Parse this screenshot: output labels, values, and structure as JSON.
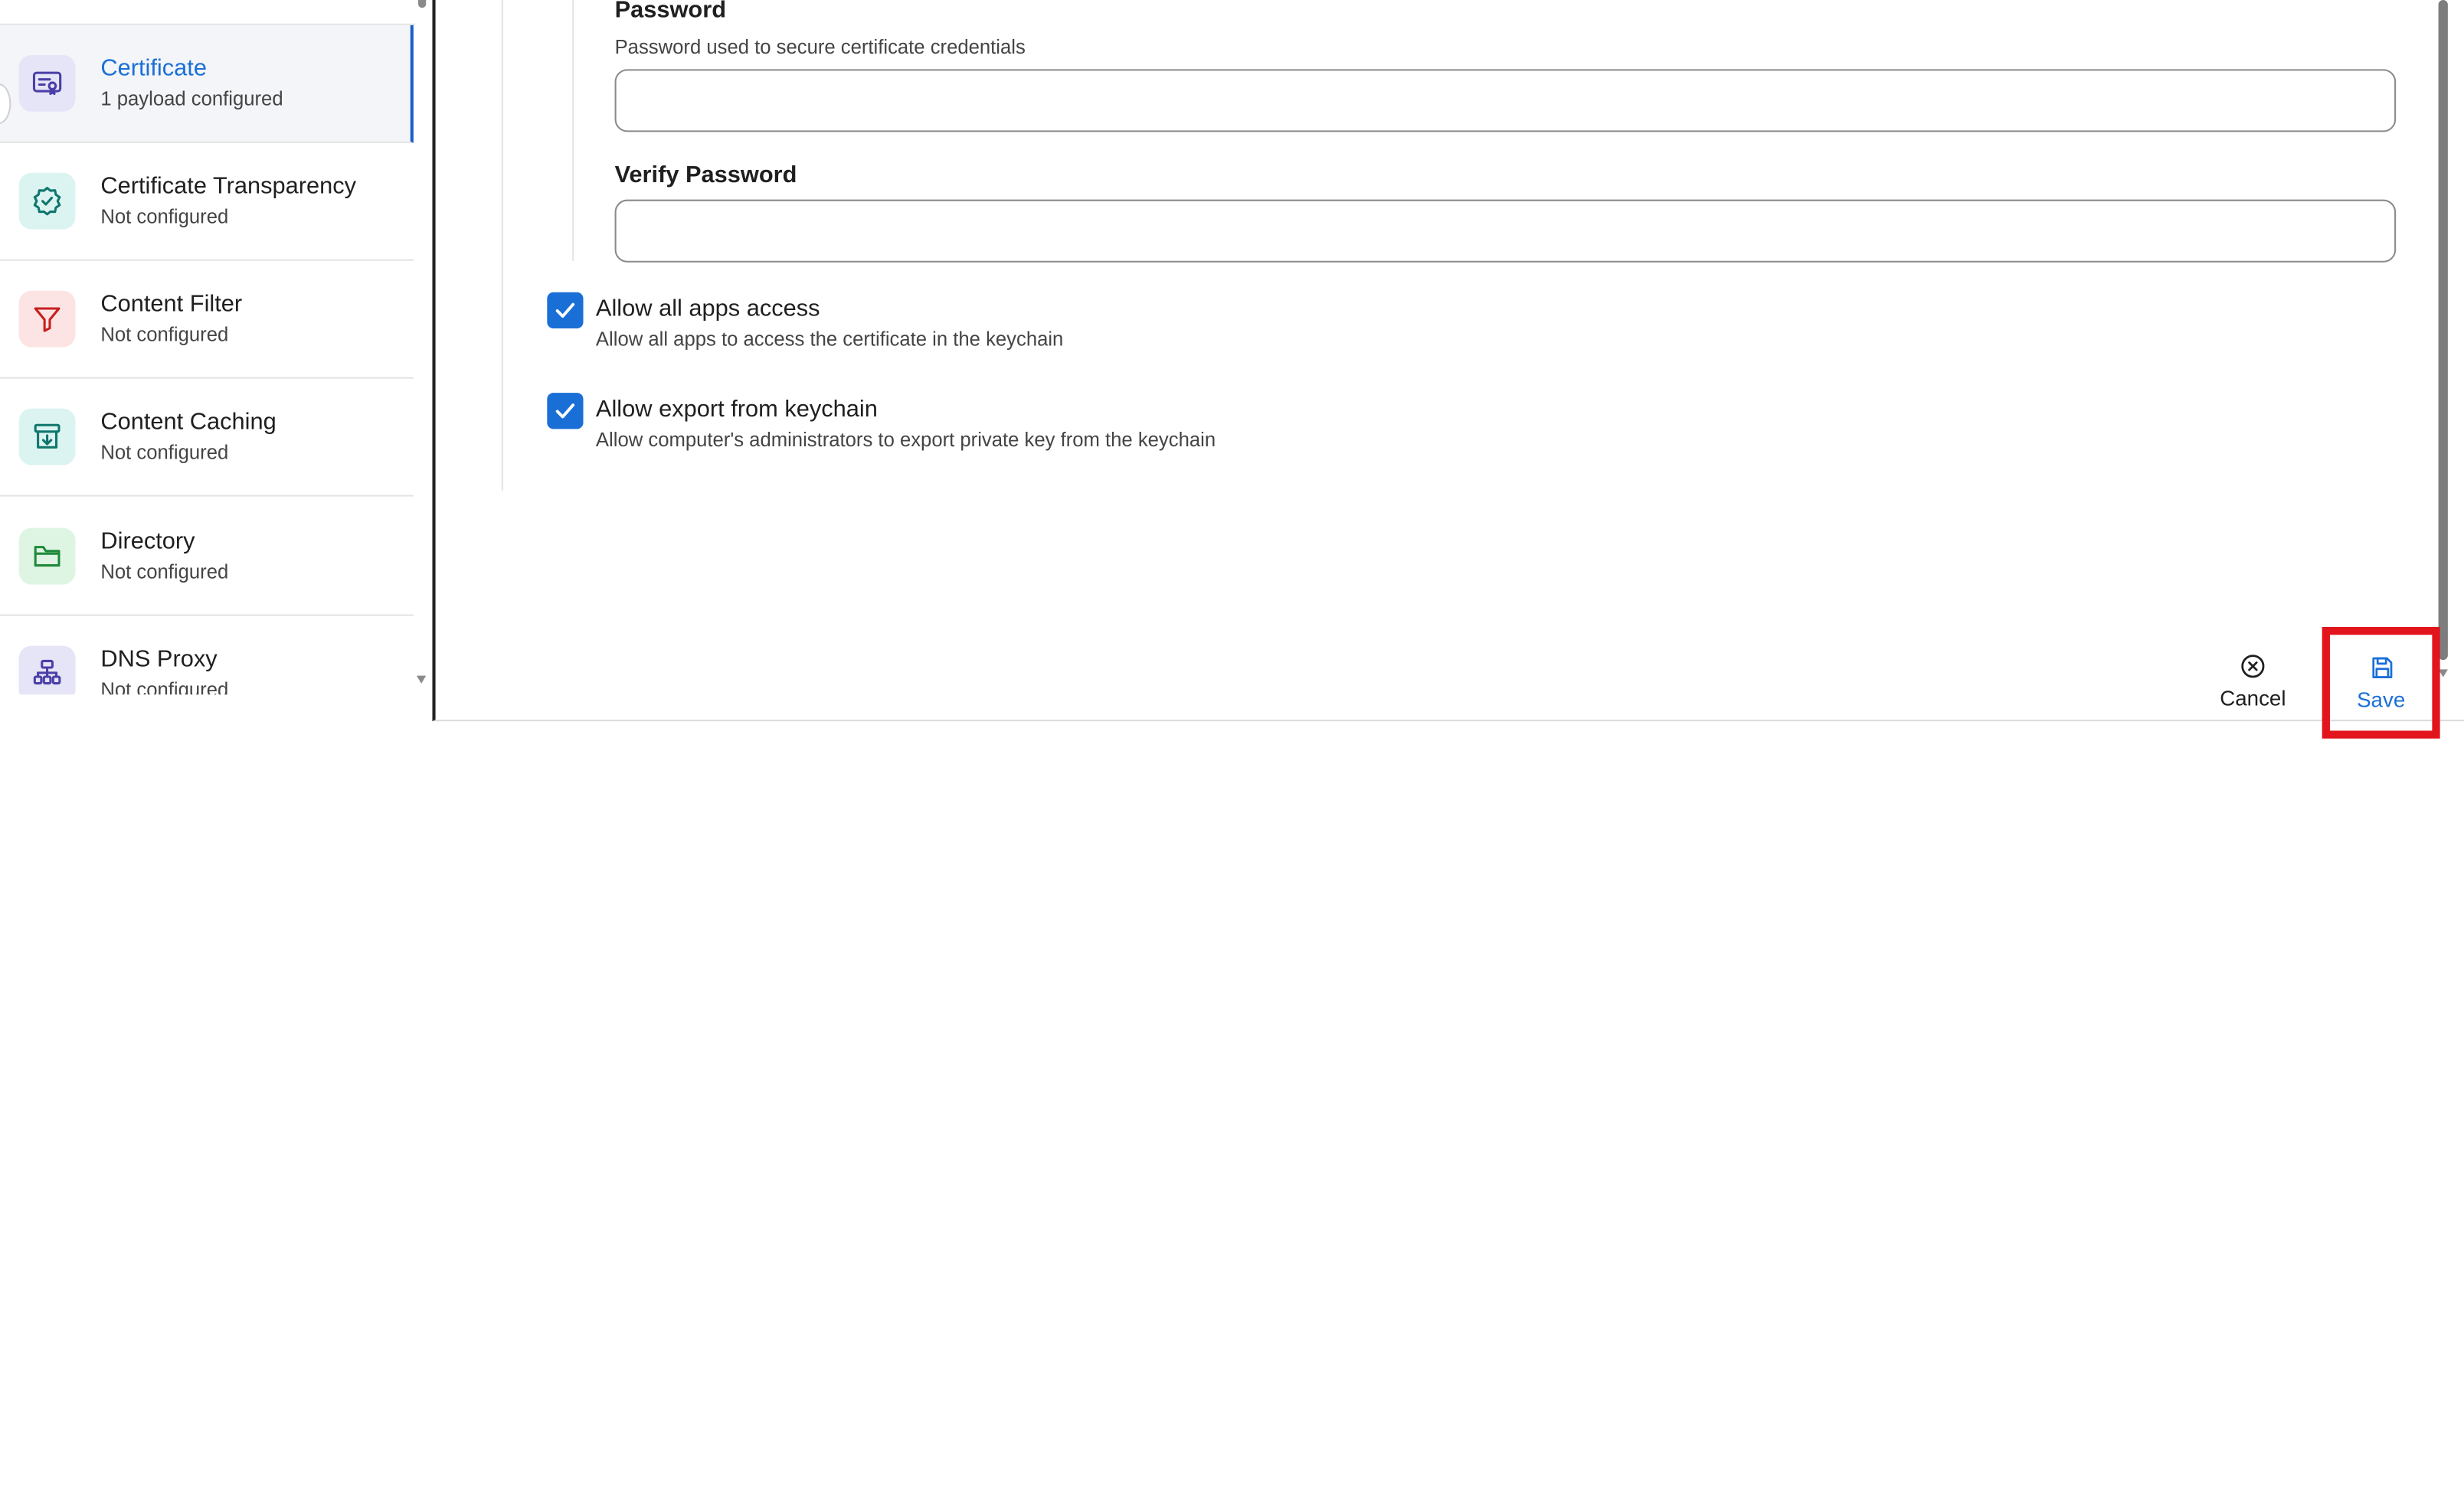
{
  "sidebar": {
    "items": [
      {
        "title": "Certificate",
        "subtitle": "1 payload configured",
        "icon": "certificate-icon",
        "icon_bg": "#e6e4f7",
        "icon_color": "#4a3fa8",
        "active": true
      },
      {
        "title": "Certificate Transparency",
        "subtitle": "Not configured",
        "icon": "check-badge-icon",
        "icon_bg": "#dcf4f1",
        "icon_color": "#0f766e",
        "active": false
      },
      {
        "title": "Content Filter",
        "subtitle": "Not configured",
        "icon": "filter-icon",
        "icon_bg": "#fde4e4",
        "icon_color": "#c81e1e",
        "active": false
      },
      {
        "title": "Content Caching",
        "subtitle": "Not configured",
        "icon": "archive-download-icon",
        "icon_bg": "#dcf4f1",
        "icon_color": "#0f766e",
        "active": false
      },
      {
        "title": "Directory",
        "subtitle": "Not configured",
        "icon": "folder-icon",
        "icon_bg": "#dff5e3",
        "icon_color": "#1f8a3a",
        "active": false
      },
      {
        "title": "DNS Proxy",
        "subtitle": "Not configured",
        "icon": "network-icon",
        "icon_bg": "#e6e4f7",
        "icon_color": "#4a3fa8",
        "active": false
      }
    ]
  },
  "form": {
    "password": {
      "label": "Password",
      "description": "Password used to secure certificate credentials",
      "value": ""
    },
    "verify_password": {
      "label": "Verify Password",
      "value": ""
    },
    "allow_all_apps": {
      "label": "Allow all apps access",
      "description": "Allow all apps to access the certificate in the keychain",
      "checked": true
    },
    "allow_export": {
      "label": "Allow export from keychain",
      "description": "Allow computer's administrators to export private key from the keychain",
      "checked": true
    }
  },
  "footer": {
    "cancel_label": "Cancel",
    "save_label": "Save"
  },
  "colors": {
    "accent": "#1a6fd6",
    "highlight": "#e2141c"
  }
}
